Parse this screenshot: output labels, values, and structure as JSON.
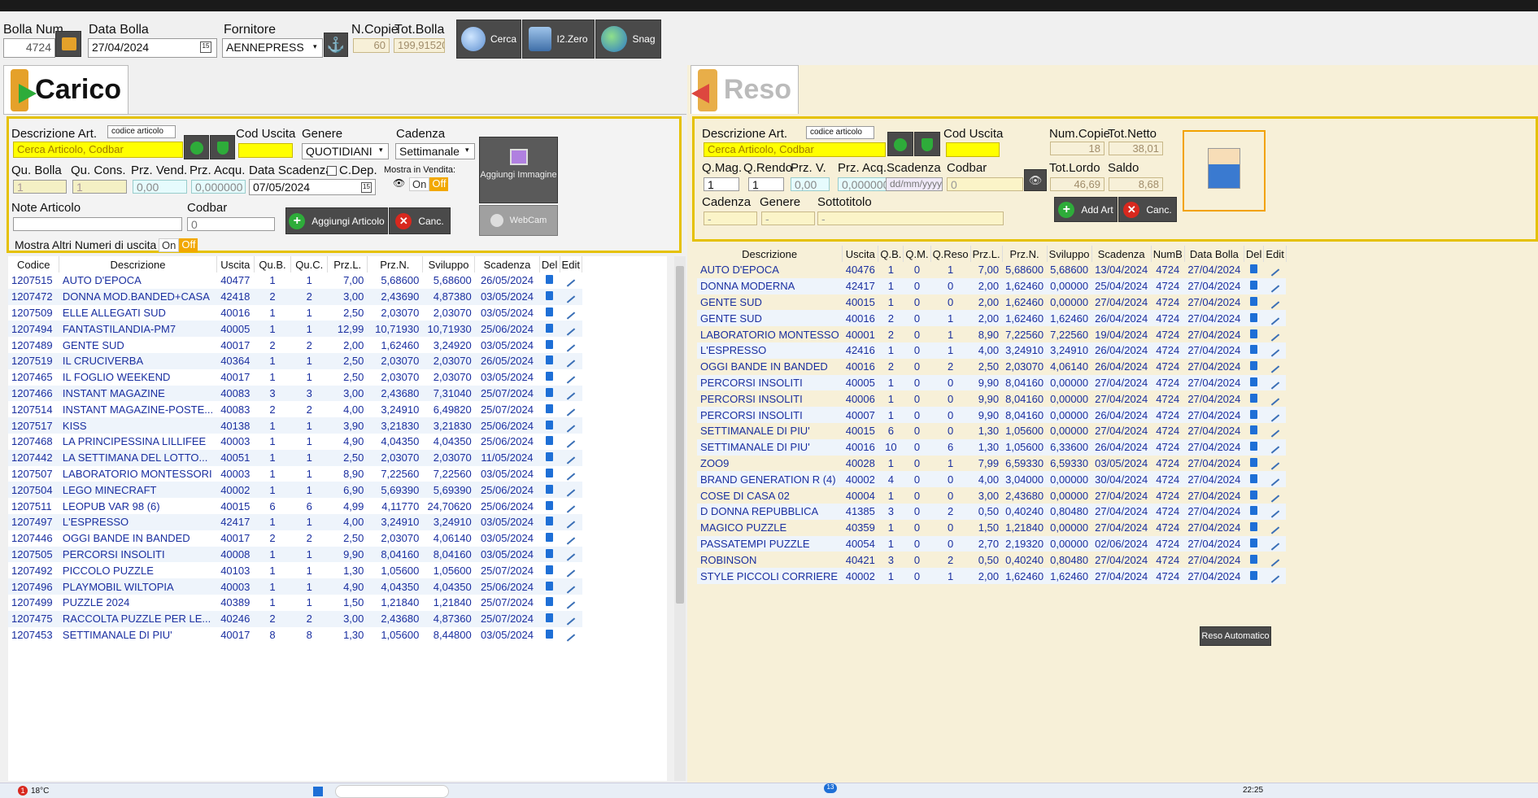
{
  "header": {
    "bolla_num_label": "Bolla Num",
    "bolla_num_value": "4724",
    "data_bolla_label": "Data Bolla",
    "data_bolla_value": "27/04/2024",
    "fornitore_label": "Fornitore",
    "fornitore_value": "AENNEPRESS",
    "ncopie_label": "N.Copie",
    "ncopie_value": "60",
    "totbolla_label": "Tot.Bolla",
    "totbolla_value": "199,91520",
    "cerca_label": "Cerca",
    "i2zero_label": "I2.Zero",
    "snag_label": "Snag"
  },
  "carico": {
    "title": "Carico",
    "descrizione_label": "Descrizione Art.",
    "codice_articolo_label": "codice articolo",
    "search_placeholder": "Cerca Articolo, Codbar",
    "cod_uscita_label": "Cod Uscita",
    "genere_label": "Genere",
    "genere_value": "QUOTIDIANI",
    "cadenza_label": "Cadenza",
    "cadenza_value": "Settimanale",
    "qu_bolla_label": "Qu. Bolla",
    "qu_bolla_value": "1",
    "qu_cons_label": "Qu. Cons.",
    "qu_cons_value": "1",
    "prz_vend_label": "Prz. Vend.",
    "prz_vend_value": "0,00",
    "prz_acqu_label": "Prz. Acqu.",
    "prz_acqu_value": "0,000000",
    "data_scadenza_label": "Data Scadenza",
    "data_scadenza_value": "07/05/2024",
    "cdep_label": "C.Dep.",
    "mostra_vendita_label": "Mostra in Vendita:",
    "on_label": "On",
    "off_label": "Off",
    "aggiungi_immagine_label": "Aggiungi Immagine",
    "webcam_label": "WebCam",
    "note_label": "Note Articolo",
    "codbar_label": "Codbar",
    "codbar_value": "0",
    "aggiungi_articolo_label": "Aggiungi Articolo",
    "canc_label": "Canc.",
    "mostra_altri_label": "Mostra Altri Numeri di uscita",
    "columns": [
      "Codice",
      "Descrizione",
      "Uscita",
      "Qu.B.",
      "Qu.C.",
      "Prz.L.",
      "Prz.N.",
      "Sviluppo",
      "Scadenza",
      "Del",
      "Edit"
    ],
    "rows": [
      [
        "1207515",
        "AUTO D'EPOCA",
        "40477",
        "1",
        "1",
        "7,00",
        "5,68600",
        "5,68600",
        "26/05/2024"
      ],
      [
        "1207472",
        "DONNA MOD.BANDED+CASA",
        "42418",
        "2",
        "2",
        "3,00",
        "2,43690",
        "4,87380",
        "03/05/2024"
      ],
      [
        "1207509",
        "ELLE ALLEGATI SUD",
        "40016",
        "1",
        "1",
        "2,50",
        "2,03070",
        "2,03070",
        "03/05/2024"
      ],
      [
        "1207494",
        "FANTASTILANDIA-PM7",
        "40005",
        "1",
        "1",
        "12,99",
        "10,71930",
        "10,71930",
        "25/06/2024"
      ],
      [
        "1207489",
        "GENTE SUD",
        "40017",
        "2",
        "2",
        "2,00",
        "1,62460",
        "3,24920",
        "03/05/2024"
      ],
      [
        "1207519",
        "IL CRUCIVERBA",
        "40364",
        "1",
        "1",
        "2,50",
        "2,03070",
        "2,03070",
        "26/05/2024"
      ],
      [
        "1207465",
        "IL FOGLIO WEEKEND",
        "40017",
        "1",
        "1",
        "2,50",
        "2,03070",
        "2,03070",
        "03/05/2024"
      ],
      [
        "1207466",
        "INSTANT MAGAZINE",
        "40083",
        "3",
        "3",
        "3,00",
        "2,43680",
        "7,31040",
        "25/07/2024"
      ],
      [
        "1207514",
        "INSTANT MAGAZINE-POSTE...",
        "40083",
        "2",
        "2",
        "4,00",
        "3,24910",
        "6,49820",
        "25/07/2024"
      ],
      [
        "1207517",
        "KISS",
        "40138",
        "1",
        "1",
        "3,90",
        "3,21830",
        "3,21830",
        "25/06/2024"
      ],
      [
        "1207468",
        "LA PRINCIPESSINA LILLIFEE",
        "40003",
        "1",
        "1",
        "4,90",
        "4,04350",
        "4,04350",
        "25/06/2024"
      ],
      [
        "1207442",
        "LA SETTIMANA DEL LOTTO...",
        "40051",
        "1",
        "1",
        "2,50",
        "2,03070",
        "2,03070",
        "11/05/2024"
      ],
      [
        "1207507",
        "LABORATORIO MONTESSORI",
        "40003",
        "1",
        "1",
        "8,90",
        "7,22560",
        "7,22560",
        "03/05/2024"
      ],
      [
        "1207504",
        "LEGO MINECRAFT",
        "40002",
        "1",
        "1",
        "6,90",
        "5,69390",
        "5,69390",
        "25/06/2024"
      ],
      [
        "1207511",
        "LEOPUB VAR 98 (6)",
        "40015",
        "6",
        "6",
        "4,99",
        "4,11770",
        "24,70620",
        "25/06/2024"
      ],
      [
        "1207497",
        "L'ESPRESSO",
        "42417",
        "1",
        "1",
        "4,00",
        "3,24910",
        "3,24910",
        "03/05/2024"
      ],
      [
        "1207446",
        "OGGI BANDE IN BANDED",
        "40017",
        "2",
        "2",
        "2,50",
        "2,03070",
        "4,06140",
        "03/05/2024"
      ],
      [
        "1207505",
        "PERCORSI INSOLITI",
        "40008",
        "1",
        "1",
        "9,90",
        "8,04160",
        "8,04160",
        "03/05/2024"
      ],
      [
        "1207492",
        "PICCOLO PUZZLE",
        "40103",
        "1",
        "1",
        "1,30",
        "1,05600",
        "1,05600",
        "25/07/2024"
      ],
      [
        "1207496",
        "PLAYMOBIL WILTOPIA",
        "40003",
        "1",
        "1",
        "4,90",
        "4,04350",
        "4,04350",
        "25/06/2024"
      ],
      [
        "1207499",
        "PUZZLE 2024",
        "40389",
        "1",
        "1",
        "1,50",
        "1,21840",
        "1,21840",
        "25/07/2024"
      ],
      [
        "1207475",
        "RACCOLTA PUZZLE PER LE...",
        "40246",
        "2",
        "2",
        "3,00",
        "2,43680",
        "4,87360",
        "25/07/2024"
      ],
      [
        "1207453",
        "SETTIMANALE DI PIU'",
        "40017",
        "8",
        "8",
        "1,30",
        "1,05600",
        "8,44800",
        "03/05/2024"
      ]
    ]
  },
  "reso": {
    "title": "Reso",
    "descrizione_label": "Descrizione Art.",
    "codice_articolo_label": "codice articolo",
    "search_placeholder": "Cerca Articolo, Codbar",
    "cod_uscita_label": "Cod Uscita",
    "num_copie_label": "Num.Copie",
    "num_copie_value": "18",
    "tot_netto_label": "Tot.Netto",
    "tot_netto_value": "38,01",
    "qmag_label": "Q.Mag.",
    "qmag_value": "1",
    "qrendo_label": "Q.Rendo",
    "qrendo_value": "1",
    "przv_label": "Prz. V.",
    "przv_value": "0,00",
    "prza_label": "Prz. Acq.",
    "prza_value": "0,000000",
    "scadenza_label": "Scadenza",
    "scadenza_value": "dd/mm/yyyy",
    "codbar_label": "Codbar",
    "codbar_value": "0",
    "tot_lordo_label": "Tot.Lordo",
    "tot_lordo_value": "46,69",
    "saldo_label": "Saldo",
    "saldo_value": "8,68",
    "cadenza_label": "Cadenza",
    "cadenza_value": "-",
    "genere_label": "Genere",
    "genere_value": "-",
    "sottotitolo_label": "Sottotitolo",
    "sottotitolo_value": "-",
    "add_art_label": "Add Art",
    "canc_label": "Canc.",
    "reso_automatico_label": "Reso Automatico",
    "columns": [
      "Descrizione",
      "Uscita",
      "Q.B.",
      "Q.M.",
      "Q.Reso",
      "Prz.L.",
      "Prz.N.",
      "Sviluppo",
      "Scadenza",
      "NumB",
      "Data Bolla",
      "Del",
      "Edit"
    ],
    "rows": [
      [
        "AUTO D'EPOCA",
        "40476",
        "1",
        "0",
        "1",
        "7,00",
        "5,68600",
        "5,68600",
        "13/04/2024",
        "4724",
        "27/04/2024"
      ],
      [
        "DONNA MODERNA",
        "42417",
        "1",
        "0",
        "0",
        "2,00",
        "1,62460",
        "0,00000",
        "25/04/2024",
        "4724",
        "27/04/2024"
      ],
      [
        "GENTE SUD",
        "40015",
        "1",
        "0",
        "0",
        "2,00",
        "1,62460",
        "0,00000",
        "27/04/2024",
        "4724",
        "27/04/2024"
      ],
      [
        "GENTE SUD",
        "40016",
        "2",
        "0",
        "1",
        "2,00",
        "1,62460",
        "1,62460",
        "26/04/2024",
        "4724",
        "27/04/2024"
      ],
      [
        "LABORATORIO MONTESSO",
        "40001",
        "2",
        "0",
        "1",
        "8,90",
        "7,22560",
        "7,22560",
        "19/04/2024",
        "4724",
        "27/04/2024"
      ],
      [
        "L'ESPRESSO",
        "42416",
        "1",
        "0",
        "1",
        "4,00",
        "3,24910",
        "3,24910",
        "26/04/2024",
        "4724",
        "27/04/2024"
      ],
      [
        "OGGI BANDE IN BANDED",
        "40016",
        "2",
        "0",
        "2",
        "2,50",
        "2,03070",
        "4,06140",
        "26/04/2024",
        "4724",
        "27/04/2024"
      ],
      [
        "PERCORSI INSOLITI",
        "40005",
        "1",
        "0",
        "0",
        "9,90",
        "8,04160",
        "0,00000",
        "27/04/2024",
        "4724",
        "27/04/2024"
      ],
      [
        "PERCORSI INSOLITI",
        "40006",
        "1",
        "0",
        "0",
        "9,90",
        "8,04160",
        "0,00000",
        "27/04/2024",
        "4724",
        "27/04/2024"
      ],
      [
        "PERCORSI INSOLITI",
        "40007",
        "1",
        "0",
        "0",
        "9,90",
        "8,04160",
        "0,00000",
        "26/04/2024",
        "4724",
        "27/04/2024"
      ],
      [
        "SETTIMANALE DI PIU'",
        "40015",
        "6",
        "0",
        "0",
        "1,30",
        "1,05600",
        "0,00000",
        "27/04/2024",
        "4724",
        "27/04/2024"
      ],
      [
        "SETTIMANALE DI PIU'",
        "40016",
        "10",
        "0",
        "6",
        "1,30",
        "1,05600",
        "6,33600",
        "26/04/2024",
        "4724",
        "27/04/2024"
      ],
      [
        "ZOO9",
        "40028",
        "1",
        "0",
        "1",
        "7,99",
        "6,59330",
        "6,59330",
        "03/05/2024",
        "4724",
        "27/04/2024"
      ],
      [
        "BRAND GENERATION R (4)",
        "40002",
        "4",
        "0",
        "0",
        "4,00",
        "3,04000",
        "0,00000",
        "30/04/2024",
        "4724",
        "27/04/2024"
      ],
      [
        "COSE DI CASA 02",
        "40004",
        "1",
        "0",
        "0",
        "3,00",
        "2,43680",
        "0,00000",
        "27/04/2024",
        "4724",
        "27/04/2024"
      ],
      [
        "D DONNA REPUBBLICA",
        "41385",
        "3",
        "0",
        "2",
        "0,50",
        "0,40240",
        "0,80480",
        "27/04/2024",
        "4724",
        "27/04/2024"
      ],
      [
        "MAGICO PUZZLE",
        "40359",
        "1",
        "0",
        "0",
        "1,50",
        "1,21840",
        "0,00000",
        "27/04/2024",
        "4724",
        "27/04/2024"
      ],
      [
        "PASSATEMPI PUZZLE",
        "40054",
        "1",
        "0",
        "0",
        "2,70",
        "2,19320",
        "0,00000",
        "02/06/2024",
        "4724",
        "27/04/2024"
      ],
      [
        "ROBINSON",
        "40421",
        "3",
        "0",
        "2",
        "0,50",
        "0,40240",
        "0,80480",
        "27/04/2024",
        "4724",
        "27/04/2024"
      ],
      [
        "STYLE PICCOLI CORRIERE",
        "40002",
        "1",
        "0",
        "1",
        "2,00",
        "1,62460",
        "1,62460",
        "27/04/2024",
        "4724",
        "27/04/2024"
      ]
    ]
  },
  "taskbar": {
    "weather": "18°C",
    "notification_count": "1",
    "badge_13": "13",
    "time": "22:25"
  }
}
